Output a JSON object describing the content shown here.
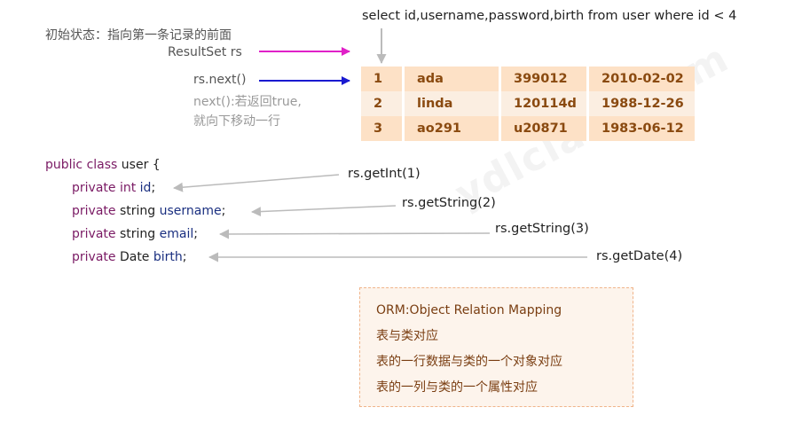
{
  "watermark": "ydlclass.com",
  "sql": "select id,username,password,birth from user where id < 4",
  "initial_state": {
    "title": "初始状态：指向第一条记录的前面",
    "resultset_label": "ResultSet rs"
  },
  "next": {
    "call": "rs.next()",
    "desc_line1": "next():若返回true,",
    "desc_line2": "就向下移动一行"
  },
  "result_rows": [
    [
      "1",
      "ada",
      "399012",
      "2010-02-02"
    ],
    [
      "2",
      "linda",
      "120114d",
      "1988-12-26"
    ],
    [
      "3",
      "ao291",
      "u20871",
      "1983-06-12"
    ]
  ],
  "class_decl": {
    "modifier": "public",
    "keyword": "class",
    "name": "user {"
  },
  "fields": [
    {
      "modifier": "private",
      "type": "int",
      "name": "id",
      "end": ";"
    },
    {
      "modifier": "private",
      "type": "string",
      "name": "username",
      "end": ";"
    },
    {
      "modifier": "private",
      "type": "string",
      "name": "email",
      "end": ";"
    },
    {
      "modifier": "private",
      "type": "Date",
      "name": "birth",
      "end": ";"
    }
  ],
  "getters": [
    "rs.getInt(1)",
    "rs.getString(2)",
    "rs.getString(3)",
    "rs.getDate(4)"
  ],
  "orm": {
    "title": "ORM:Object Relation Mapping",
    "lines": [
      "表与类对应",
      "表的一行数据与类的一个对象对应",
      "表的一列与类的一个属性对应"
    ]
  },
  "colors": {
    "initial_arrow": "#e020c8",
    "next_arrow": "#1a1ad0",
    "gray_arrow": "#bbbbbb",
    "table_dark": "#fde1c6",
    "table_light": "#fbeee1",
    "table_text": "#8a4a10"
  }
}
